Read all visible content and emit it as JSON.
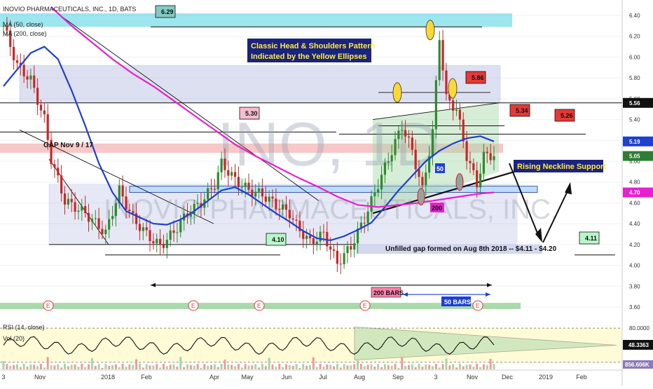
{
  "header": {
    "symbol_title": "INOVIO PHARMACEUTICALS, INC., 1D, BATS",
    "ma1_label": "MA (50, close)",
    "ma2_label": "MA (200, close)"
  },
  "watermark": {
    "ticker": "INO, 1D",
    "company": "INOVIO PHARMACEUTICALS, INC."
  },
  "annotations": {
    "pattern_title_line1": "Classic Head & Shoulders Pattern",
    "pattern_title_line2": "Indicated by the Yellow Ellipses",
    "gap_label": "GAP Nov 9 / 17",
    "neckline_label": "Rising Neckline Support",
    "unfilled_gap": "Unfilled gap formed on Aug 8th 2018 -- $4.11 - $4.20",
    "bars_200": "200 BARS",
    "bars_50": "50 BARS",
    "ma50_tag": "50",
    "ma200_tag": "200",
    "callouts": [
      "6.29",
      "5.30",
      "4.10",
      "5.86",
      "5.34",
      "5.26",
      "4.11"
    ],
    "earnings_marker": "E"
  },
  "indicators": {
    "rsi_label": "RSI (14, close)",
    "vol_label": "Vol (20)",
    "rsi_value": "48.3363",
    "vol_value": "856.606K",
    "rsi_level": "80.0000",
    "rsi_low": "20"
  },
  "colors": {
    "ma50": "#1f3fd1",
    "ma200": "#e81fd0",
    "up_candle": "#2e8b2e",
    "down_candle": "#c62828",
    "resistance_band": "#4dd0e1",
    "support_band": "#66bb6a",
    "gap_band": "#ef9a9a",
    "range_box": "#9fa8da",
    "callout_red": "#e53935",
    "callout_green": "#a5d6a7",
    "price_tag_blue": "#1f3fd1",
    "price_tag_pink": "#e81fd0",
    "banner_bg": "#1a237e",
    "banner_text": "#ffeb3b"
  },
  "chart_data": {
    "type": "candlestick",
    "x_ticks": [
      "3",
      "Nov",
      "2018",
      "Feb",
      "Apr",
      "May",
      "Jun",
      "Jul",
      "Aug",
      "Sep",
      "3",
      "Nov",
      "Dec",
      "2019",
      "Feb"
    ],
    "y_ticks": [
      "6.40",
      "6.20",
      "6.00",
      "5.80",
      "5.60",
      "5.40",
      "5.20",
      "5.00",
      "4.80",
      "4.60",
      "4.40",
      "4.20",
      "4.00",
      "3.80",
      "3.60"
    ],
    "ylim": [
      3.52,
      6.52
    ],
    "price_tags": [
      {
        "value": "5.56",
        "style": "dark"
      },
      {
        "value": "5.19",
        "style": "blue"
      },
      {
        "value": "5.05",
        "style": "green"
      },
      {
        "value": "4.70",
        "style": "pink"
      }
    ],
    "levels": {
      "resistance_band": [
        6.29,
        6.42
      ],
      "support_band": [
        3.58,
        3.64
      ],
      "gap_band": [
        5.08,
        5.17
      ],
      "unfilled_gap": [
        4.11,
        4.2
      ],
      "hlines": [
        6.29,
        5.56,
        5.26,
        4.41,
        4.1,
        3.8
      ]
    },
    "series": [
      {
        "name": "MA (50, close)",
        "points": [
          [
            0,
            5.72
          ],
          [
            4,
            5.88
          ],
          [
            8,
            6.04
          ],
          [
            12,
            6.1
          ],
          [
            16,
            5.98
          ],
          [
            20,
            5.68
          ],
          [
            24,
            5.34
          ],
          [
            28,
            4.98
          ],
          [
            32,
            4.7
          ],
          [
            36,
            4.52
          ],
          [
            40,
            4.46
          ],
          [
            44,
            4.4
          ],
          [
            48,
            4.39
          ],
          [
            52,
            4.44
          ],
          [
            56,
            4.52
          ],
          [
            60,
            4.62
          ],
          [
            64,
            4.72
          ],
          [
            68,
            4.75
          ],
          [
            72,
            4.68
          ],
          [
            76,
            4.59
          ],
          [
            80,
            4.5
          ],
          [
            84,
            4.42
          ],
          [
            88,
            4.33
          ],
          [
            92,
            4.26
          ],
          [
            96,
            4.24
          ],
          [
            100,
            4.28
          ],
          [
            104,
            4.34
          ],
          [
            108,
            4.41
          ],
          [
            112,
            4.56
          ],
          [
            116,
            4.72
          ],
          [
            120,
            4.86
          ],
          [
            124,
            5.0
          ],
          [
            128,
            5.1
          ],
          [
            132,
            5.17
          ],
          [
            136,
            5.22
          ],
          [
            140,
            5.24
          ],
          [
            144,
            5.19
          ]
        ]
      },
      {
        "name": "MA (200, close)",
        "points": [
          [
            14,
            6.48
          ],
          [
            20,
            6.3
          ],
          [
            26,
            6.14
          ],
          [
            32,
            5.98
          ],
          [
            38,
            5.84
          ],
          [
            44,
            5.72
          ],
          [
            50,
            5.58
          ],
          [
            56,
            5.44
          ],
          [
            62,
            5.3
          ],
          [
            68,
            5.16
          ],
          [
            74,
            5.05
          ],
          [
            80,
            4.95
          ],
          [
            86,
            4.85
          ],
          [
            92,
            4.76
          ],
          [
            98,
            4.66
          ],
          [
            104,
            4.58
          ],
          [
            110,
            4.56
          ],
          [
            116,
            4.58
          ],
          [
            122,
            4.6
          ],
          [
            128,
            4.63
          ],
          [
            134,
            4.66
          ],
          [
            140,
            4.69
          ],
          [
            144,
            4.7
          ]
        ]
      }
    ],
    "rsi": {
      "ylim": [
        10,
        90
      ],
      "level_high": 80,
      "level_low": 20,
      "last": 48.34
    },
    "volume": {
      "last": "856.606K"
    }
  }
}
